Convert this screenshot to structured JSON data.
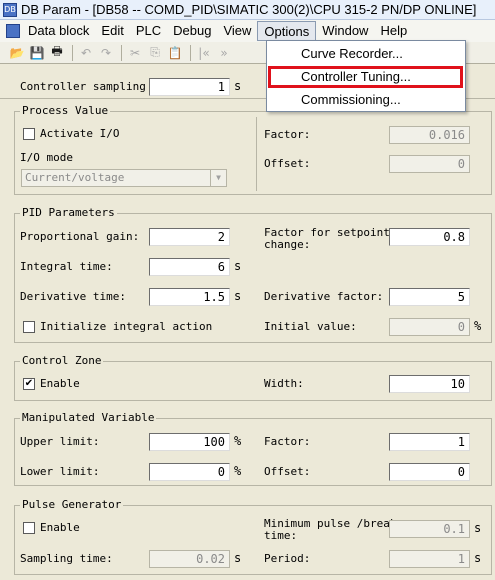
{
  "window": {
    "title": "DB Param - [DB58 -- COMD_PID\\SIMATIC 300(2)\\CPU 315-2 PN/DP  ONLINE]",
    "app_icon": "db-param-icon"
  },
  "menu": {
    "items": [
      {
        "label": "Data block"
      },
      {
        "label": "Edit"
      },
      {
        "label": "PLC"
      },
      {
        "label": "Debug"
      },
      {
        "label": "View"
      },
      {
        "label": "Options"
      },
      {
        "label": "Window"
      },
      {
        "label": "Help"
      }
    ],
    "active": "Options"
  },
  "options_menu": {
    "items": [
      {
        "label": "Curve Recorder..."
      },
      {
        "label": "Controller Tuning..."
      },
      {
        "label": "Commissioning..."
      }
    ],
    "highlight_color": "#e0111b"
  },
  "toolbar": {
    "icons": [
      "open-icon",
      "save-icon",
      "print-icon",
      "undo-icon",
      "redo-icon",
      "cut-icon",
      "copy-icon",
      "paste-icon",
      "first-icon",
      "next-icon"
    ]
  },
  "controller_sampling": {
    "label": "Controller sampling",
    "value": "1",
    "unit": "s"
  },
  "process_value": {
    "title": "Process Value",
    "activate_io": {
      "label": "Activate I/O",
      "checked": false
    },
    "io_mode_label": "I/O mode",
    "io_mode_value": "Current/voltage",
    "factor": {
      "label": "Factor:",
      "value": "0.016"
    },
    "offset": {
      "label": "Offset:",
      "value": "0"
    }
  },
  "pid": {
    "title": "PID Parameters",
    "proportional_gain": {
      "label": "Proportional gain:",
      "value": "2"
    },
    "integral_time": {
      "label": "Integral time:",
      "value": "6",
      "unit": "s"
    },
    "derivative_time": {
      "label": "Derivative time:",
      "value": "1.5",
      "unit": "s"
    },
    "init_integral": {
      "label": "Initialize integral action",
      "checked": false
    },
    "factor_setpoint": {
      "label_line1": "Factor for setpoint",
      "label_line2": "change:",
      "value": "0.8"
    },
    "derivative_factor": {
      "label": "Derivative factor:",
      "value": "5"
    },
    "initial_value": {
      "label": "Initial value:",
      "value": "0",
      "unit": "%"
    }
  },
  "control_zone": {
    "title": "Control Zone",
    "enable": {
      "label": "Enable",
      "checked": true
    },
    "width": {
      "label": "Width:",
      "value": "10"
    }
  },
  "manipulated": {
    "title": "Manipulated Variable",
    "upper_limit": {
      "label": "Upper limit:",
      "value": "100",
      "unit": "%"
    },
    "lower_limit": {
      "label": "Lower limit:",
      "value": "0",
      "unit": "%"
    },
    "factor": {
      "label": "Factor:",
      "value": "1"
    },
    "offset": {
      "label": "Offset:",
      "value": "0"
    }
  },
  "pulse": {
    "title": "Pulse Generator",
    "enable": {
      "label": "Enable",
      "checked": false
    },
    "min_pulse": {
      "label_line1": "Minimum pulse /break",
      "label_line2": "time:",
      "value": "0.1",
      "unit": "s"
    },
    "sampling_time": {
      "label": "Sampling time:",
      "value": "0.02",
      "unit": "s"
    },
    "period": {
      "label": "Period:",
      "value": "1",
      "unit": "s"
    }
  }
}
